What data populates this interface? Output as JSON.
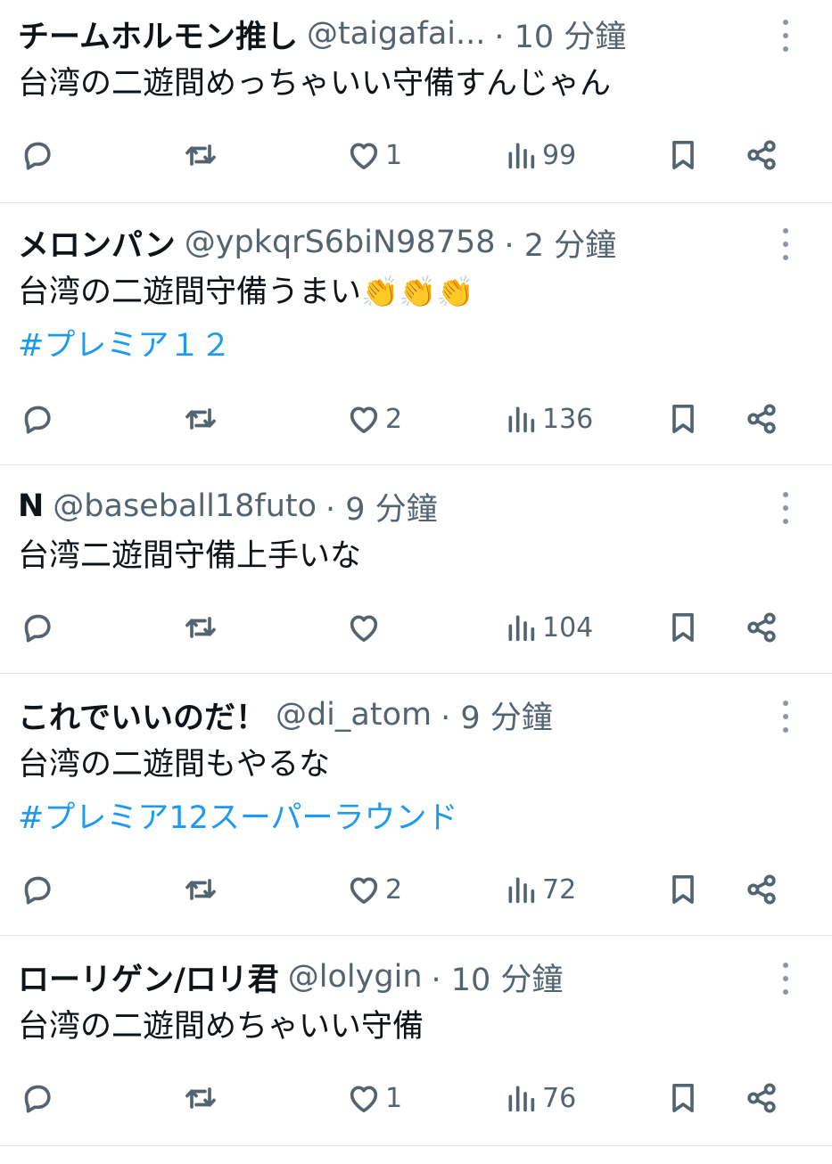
{
  "tweets": [
    {
      "name": "チームホルモン推し",
      "handle": "@taigafai...",
      "time": "· 10 分鐘",
      "text": "台湾の二遊間めっちゃいい守備すんじゃん",
      "hashtag": "",
      "likes": "1",
      "views": "99"
    },
    {
      "name": "メロンパン",
      "handle": "@ypkqrS6biN98758",
      "time": "· 2 分鐘",
      "text": "台湾の二遊間守備うまい",
      "emoji": "👏👏👏",
      "hashtag": "#プレミア１２",
      "likes": "2",
      "views": "136"
    },
    {
      "name": "N",
      "handle": "@baseball18futo",
      "time": "· 9 分鐘",
      "text": "台湾二遊間守備上手いな",
      "hashtag": "",
      "likes": "",
      "views": "104"
    },
    {
      "name": "これでいいのだ！",
      "handle": "@di_atom",
      "time": "· 9 分鐘",
      "text": "台湾の二遊間もやるな",
      "hashtag": "#プレミア12スーパーラウンド",
      "likes": "2",
      "views": "72"
    },
    {
      "name": "ローリゲン/ロリ君",
      "handle": "@lolygin",
      "time": "· 10 分鐘",
      "text": "台湾の二遊間めちゃいい守備",
      "hashtag": "",
      "likes": "1",
      "views": "76"
    }
  ],
  "icons": {
    "reply": "reply-icon",
    "retweet": "retweet-icon",
    "like": "heart-icon",
    "views": "views-icon",
    "bookmark": "bookmark-icon",
    "share": "share-icon",
    "more": "more-icon"
  },
  "colors": {
    "hashtag": "#1d9bf0",
    "meta": "#536471",
    "text": "#0f1419"
  }
}
